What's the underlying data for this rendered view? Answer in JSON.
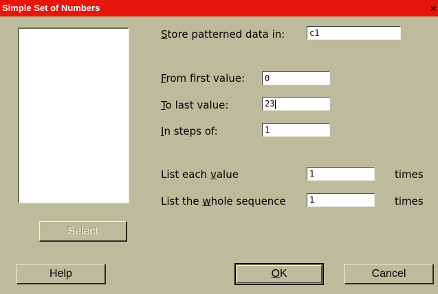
{
  "window": {
    "title": "Simple Set of Numbers",
    "close_glyph": "×"
  },
  "list": {
    "items": []
  },
  "fields": {
    "store": {
      "label_pre": "",
      "label_u": "S",
      "label_post": "tore patterned data in:",
      "value": "c1"
    },
    "from_first": {
      "label_pre": "",
      "label_u": "F",
      "label_post": "rom first value:",
      "value": "0"
    },
    "to_last": {
      "label_pre": "",
      "label_u": "T",
      "label_post": "o last value:",
      "value": "23"
    },
    "in_steps": {
      "label_pre": "",
      "label_u": "I",
      "label_post": "n steps of:",
      "value": "1"
    },
    "list_each": {
      "label_pre": "List each ",
      "label_u": "v",
      "label_post": "alue",
      "value": "1",
      "suffix": "times"
    },
    "list_whole": {
      "label_pre": "List the ",
      "label_u": "w",
      "label_post": "hole sequence",
      "value": "1",
      "suffix": "times"
    }
  },
  "buttons": {
    "select": {
      "label": "Select",
      "enabled": false
    },
    "help": {
      "label": "Help"
    },
    "ok": {
      "label_u": "O",
      "label_post": "K"
    },
    "cancel": {
      "label": "Cancel"
    }
  },
  "colors": {
    "title_bar": "#e8150b",
    "dialog_background": "#bcbc9c",
    "field_background": "#ffffff"
  },
  "icons": {
    "close": "close-icon"
  }
}
